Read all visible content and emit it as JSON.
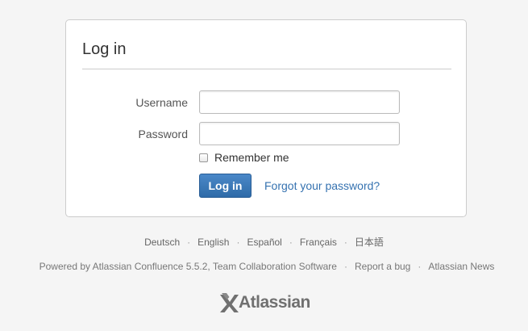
{
  "login": {
    "title": "Log in",
    "username_label": "Username",
    "username_value": "",
    "password_label": "Password",
    "password_value": "",
    "remember_label": "Remember me",
    "remember_checked": false,
    "submit_label": "Log in",
    "forgot_label": "Forgot your password?"
  },
  "languages": [
    "Deutsch",
    "English",
    "Español",
    "Français",
    "日本語"
  ],
  "footer": {
    "powered_by": "Powered by Atlassian Confluence 5.5.2, Team Collaboration Software",
    "report_bug": "Report a bug",
    "news": "Atlassian News"
  },
  "logo": {
    "text": "Atlassian",
    "icon": "atlassian-x-icon"
  },
  "colors": {
    "background": "#f5f5f5",
    "primary_button": "#3572b0",
    "link": "#3572b0"
  }
}
